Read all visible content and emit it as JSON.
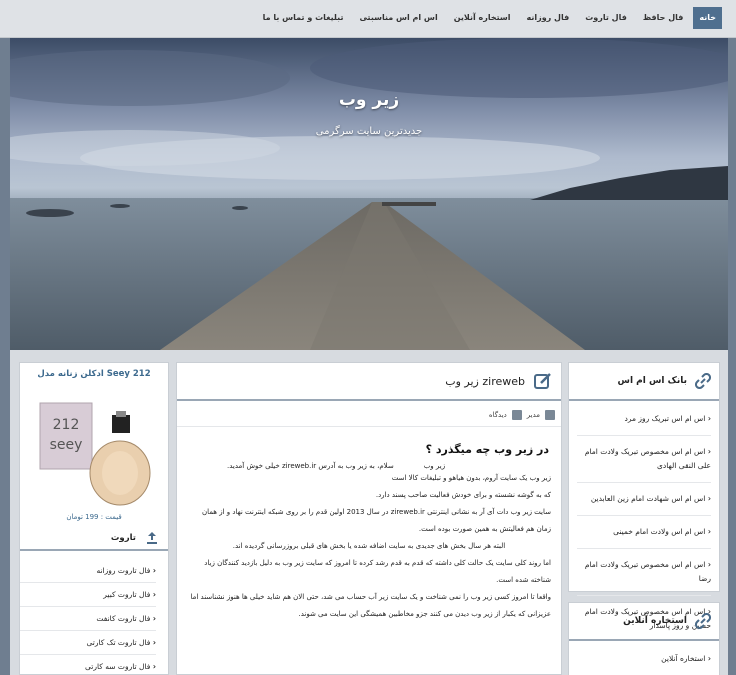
{
  "nav": {
    "items": [
      {
        "label": "خانه",
        "active": true
      },
      {
        "label": "فال حافظ"
      },
      {
        "label": "فال تاروت"
      },
      {
        "label": "فال روزانه"
      },
      {
        "label": "استخاره آنلاین"
      },
      {
        "label": "اس ام اس مناسبتی"
      },
      {
        "label": "تبلیغات و تماس با ما"
      }
    ]
  },
  "hero": {
    "site_title": "زیر وب",
    "tagline": "جدیدترین سایت سرگرمی"
  },
  "right_sidebar": {
    "sms": {
      "title": "بانک اس ام اس",
      "items": [
        "اس ام اس تبریک روز مرد",
        "اس ام اس مخصوص تبریک ولادت امام علی النقی الهادی",
        "اس ام اس شهادت امام زین العابدین",
        "اس ام اس ولادت امام خمینی",
        "اس ام اس مخصوص تبریک ولادت امام رضا",
        "اس ام اس مخصوص تبریک ولادت امام حسین و روز پاسدار"
      ]
    },
    "istikhara": {
      "title": "استخاره آنلاین",
      "items": [
        "استخاره آنلاین"
      ]
    }
  },
  "post": {
    "header_title": "زیر وب zireweb",
    "author": "مدیر",
    "category": "دیدگاه",
    "title": "در زیر وب چه میگذرد ؟",
    "brand_label": "زیر وب",
    "intro": "سلام، به زیر وب به آدرس zireweb.ir خیلی خوش آمدید.",
    "p1": "زیر وب یک سایت آروم، بدون هیاهو و تبلیغات کالا است",
    "p2": "که به گوشه نشسته و برای خودش فعالیت صاحب پسند دارد.",
    "p3": "سایت زیر وب دات آی آر به نشانی اینترنتی zireweb.ir در سال 2013 اولین قدم را بر روی شبکه اینترنت نهاد و از همان زمان هم فعالیتش به همین صورت بوده است.",
    "p4": "البته هر سال بخش های جدیدی به سایت اضافه شده یا بخش های قبلی بروزرسانی گردیده اند.",
    "p5": "اما روند کلی سایت یک حالت کلی داشته که قدم به قدم رشد کرده تا امروز که سایت زیر وب به دلیل بازدید کنندگان زیاد شناخته شده است.",
    "p6": "واقعا تا امروز کسی زیر وب را نمی شناخت و یک سایت زیر آب حساب می شد، حتی الان هم شاید خیلی ها هنوز نشناسند اما عزیزانی که یکبار از زیر وب دیدن می کنند جزو مخاطبین همیشگی این سایت می شوند."
  },
  "left_sidebar": {
    "ad": {
      "title": "ادکلن زنانه مدل Seey 212",
      "price": "قیمت : 199 تومان",
      "box_text_1": "212",
      "box_text_2": "seey"
    },
    "tarot": {
      "title": "تاروت",
      "items": [
        "فال تاروت روزانه",
        "فال تاروت کبیر",
        "فال تاروت کانفت",
        "فال تاروت تک کارتی",
        "فال تاروت سه کارتی"
      ]
    }
  },
  "colors": {
    "accent": "#4f6f8f",
    "page_bg": "#6f7e90",
    "link_blue": "#3d6a8e"
  }
}
